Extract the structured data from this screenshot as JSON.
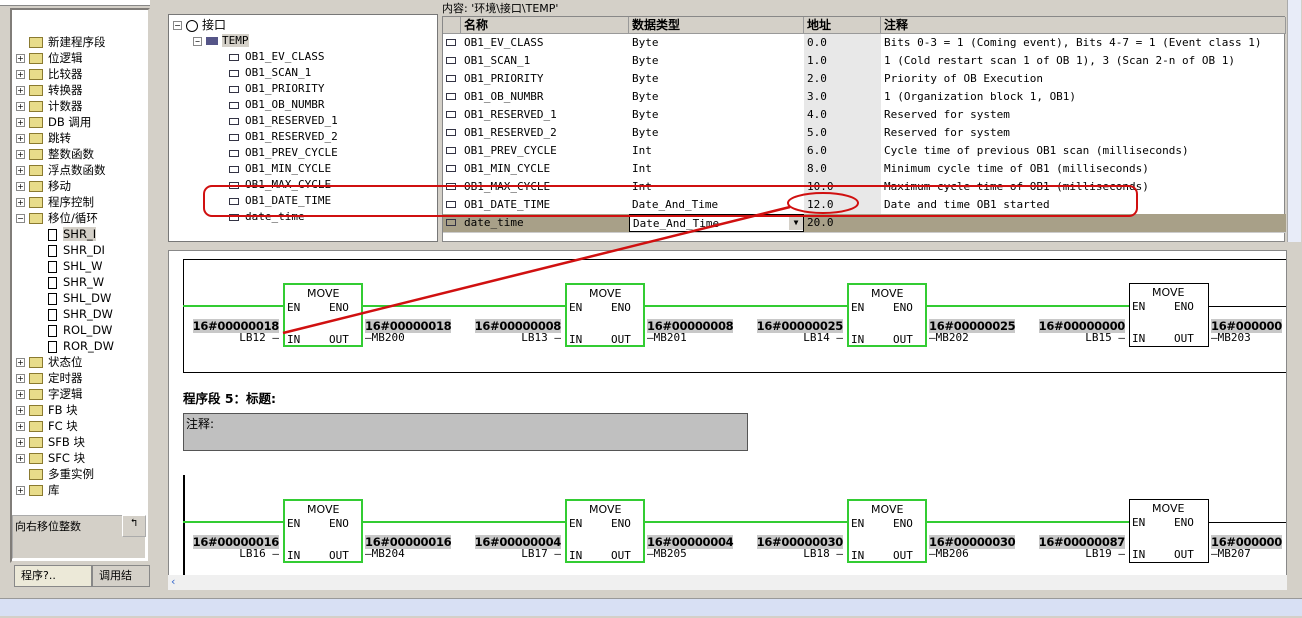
{
  "left_tree": {
    "items": [
      {
        "label": "新建程序段",
        "icon": "new-network-icon",
        "expander": ""
      },
      {
        "label": "位逻辑",
        "icon": "folder-icon",
        "expander": "+"
      },
      {
        "label": "比较器",
        "icon": "folder-icon",
        "expander": "+"
      },
      {
        "label": "转换器",
        "icon": "folder-icon",
        "expander": "+"
      },
      {
        "label": "计数器",
        "icon": "folder-icon",
        "expander": "+"
      },
      {
        "label": "DB 调用",
        "icon": "folder-icon",
        "expander": "+"
      },
      {
        "label": "跳转",
        "icon": "folder-icon",
        "expander": "+"
      },
      {
        "label": "整数函数",
        "icon": "folder-icon",
        "expander": "+"
      },
      {
        "label": "浮点数函数",
        "icon": "folder-icon",
        "expander": "+"
      },
      {
        "label": "移动",
        "icon": "folder-icon",
        "expander": "+"
      },
      {
        "label": "程序控制",
        "icon": "folder-icon",
        "expander": "+"
      },
      {
        "label": "移位/循环",
        "icon": "folder-icon",
        "expander": "-"
      },
      {
        "label": "SHR_I",
        "icon": "block-icon",
        "child": true,
        "selected": true
      },
      {
        "label": "SHR_DI",
        "icon": "block-icon",
        "child": true
      },
      {
        "label": "SHL_W",
        "icon": "block-icon",
        "child": true
      },
      {
        "label": "SHR_W",
        "icon": "block-icon",
        "child": true
      },
      {
        "label": "SHL_DW",
        "icon": "block-icon",
        "child": true
      },
      {
        "label": "SHR_DW",
        "icon": "block-icon",
        "child": true
      },
      {
        "label": "ROL_DW",
        "icon": "block-icon",
        "child": true
      },
      {
        "label": "ROR_DW",
        "icon": "block-icon",
        "child": true
      },
      {
        "label": "状态位",
        "icon": "folder-icon",
        "expander": "+"
      },
      {
        "label": "定时器",
        "icon": "folder-icon",
        "expander": "+"
      },
      {
        "label": "字逻辑",
        "icon": "folder-icon",
        "expander": "+"
      },
      {
        "label": "FB 块",
        "icon": "folder-icon",
        "expander": "+"
      },
      {
        "label": "FC 块",
        "icon": "folder-icon",
        "expander": "+"
      },
      {
        "label": "SFB 块",
        "icon": "folder-icon",
        "expander": "+"
      },
      {
        "label": "SFC 块",
        "icon": "folder-icon",
        "expander": "+"
      },
      {
        "label": "多重实例",
        "icon": "multi-instance-icon",
        "expander": ""
      },
      {
        "label": "库",
        "icon": "library-icon",
        "expander": "+"
      }
    ],
    "description": "向右移位整数",
    "tabs": [
      "程序?..",
      "调用结"
    ]
  },
  "interface_tree": {
    "root": "接口",
    "temp": "TEMP",
    "vars": [
      "OB1_EV_CLASS",
      "OB1_SCAN_1",
      "OB1_PRIORITY",
      "OB1_OB_NUMBR",
      "OB1_RESERVED_1",
      "OB1_RESERVED_2",
      "OB1_PREV_CYCLE",
      "OB1_MIN_CYCLE",
      "OB1_MAX_CYCLE",
      "OB1_DATE_TIME",
      "date_time"
    ]
  },
  "table": {
    "content_label": "内容: '环境\\接口\\TEMP'",
    "headers": [
      "名称",
      "数据类型",
      "地址",
      "注释"
    ],
    "rows": [
      [
        "OB1_EV_CLASS",
        "Byte",
        "0.0",
        "Bits 0-3 = 1 (Coming event), Bits 4-7 = 1 (Event class 1)"
      ],
      [
        "OB1_SCAN_1",
        "Byte",
        "1.0",
        "1 (Cold restart scan 1 of OB 1), 3 (Scan 2-n of OB 1)"
      ],
      [
        "OB1_PRIORITY",
        "Byte",
        "2.0",
        "Priority of OB Execution"
      ],
      [
        "OB1_OB_NUMBR",
        "Byte",
        "3.0",
        "1 (Organization block 1, OB1)"
      ],
      [
        "OB1_RESERVED_1",
        "Byte",
        "4.0",
        "Reserved for system"
      ],
      [
        "OB1_RESERVED_2",
        "Byte",
        "5.0",
        "Reserved for system"
      ],
      [
        "OB1_PREV_CYCLE",
        "Int",
        "6.0",
        "Cycle time of previous OB1 scan (milliseconds)"
      ],
      [
        "OB1_MIN_CYCLE",
        "Int",
        "8.0",
        "Minimum cycle time of OB1 (milliseconds)"
      ],
      [
        "OB1_MAX_CYCLE",
        "Int",
        "10.0",
        "Maximum cycle time of OB1 (milliseconds)"
      ],
      [
        "OB1_DATE_TIME",
        "Date_And_Time",
        "12.0",
        "Date and time OB1 started"
      ],
      [
        "date_time",
        "Date_And_Time",
        "20.0",
        ""
      ]
    ]
  },
  "network": {
    "segment_title": "程序段 5：标题:",
    "comment_label": "注释:",
    "box_title": "MOVE",
    "en": "EN",
    "eno": "ENO",
    "in": "IN",
    "out": "OUT",
    "rungs": [
      [
        {
          "in_val": "16#00000018",
          "in": "LB12",
          "out_val": "16#00000018",
          "out": "MB200"
        },
        {
          "in_val": "16#00000008",
          "in": "LB13",
          "out_val": "16#00000008",
          "out": "MB201"
        },
        {
          "in_val": "16#00000025",
          "in": "LB14",
          "out_val": "16#00000025",
          "out": "MB202"
        },
        {
          "in_val": "16#00000000",
          "in": "LB15",
          "out_val": "16#000000",
          "out": "MB203",
          "inactive": true
        }
      ],
      [
        {
          "in_val": "16#00000016",
          "in": "LB16",
          "out_val": "16#00000016",
          "out": "MB204"
        },
        {
          "in_val": "16#00000004",
          "in": "LB17",
          "out_val": "16#00000004",
          "out": "MB205"
        },
        {
          "in_val": "16#00000030",
          "in": "LB18",
          "out_val": "16#00000030",
          "out": "MB206"
        },
        {
          "in_val": "16#00000087",
          "in": "LB19",
          "out_val": "16#000000",
          "out": "MB207",
          "inactive": true
        }
      ]
    ]
  },
  "colors": {
    "power_flow": "#33cc33",
    "annotation": "#d01010",
    "selected_row": "#a8a088"
  }
}
